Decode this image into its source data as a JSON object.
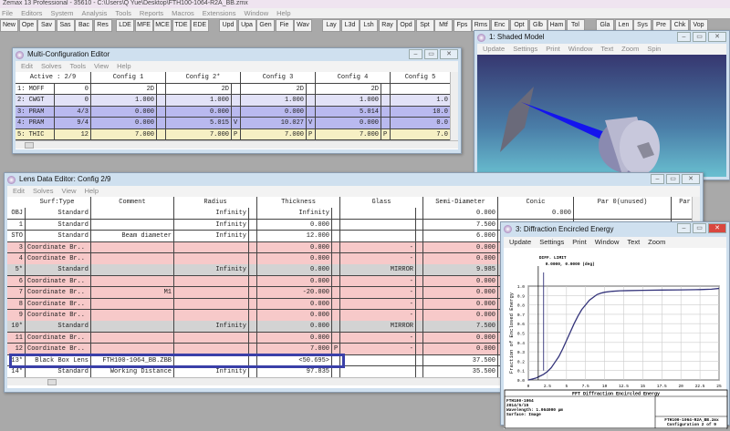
{
  "app": {
    "title": "Zemax 13 Professional - 35610 - C:\\Users\\Q Yue\\Desktop\\FTH100-1064-R2A_BB.zmx",
    "menu": [
      "File",
      "Editors",
      "System",
      "Analysis",
      "Tools",
      "Reports",
      "Macros",
      "Extensions",
      "Window",
      "Help"
    ],
    "toolbar": [
      [
        "New",
        "Ope",
        "Sav",
        "Sas",
        "Bac",
        "Res"
      ],
      [
        "LDE",
        "MFE",
        "MCE",
        "TDE",
        "EDE"
      ],
      [
        "Upd",
        "Upa",
        "Gen",
        "Fie",
        "Wav"
      ],
      [
        "Lay",
        "L3d",
        "Lsh",
        "Ray",
        "Opd",
        "Spt",
        "Mtf",
        "Fps",
        "Rms",
        "Enc"
      ],
      [
        "Opt",
        "Glb",
        "Ham",
        "Tol"
      ],
      [
        "Gla",
        "Len",
        "Sys",
        "Pre",
        "Chk",
        "Vop"
      ]
    ]
  },
  "mce": {
    "title": "Multi-Configuration Editor",
    "menu": [
      "Edit",
      "Solves",
      "Tools",
      "View",
      "Help"
    ],
    "headers": [
      "Active : 2/9",
      "Config 1",
      "Config 2*",
      "Config 3",
      "Config 4",
      "Config 5"
    ],
    "rows": [
      {
        "op": "1: MOFF",
        "val": "0",
        "cfg": [
          "2D",
          "2D",
          "2D",
          "2D",
          ""
        ],
        "sv": [
          "",
          "",
          "",
          "",
          ""
        ],
        "color": "#ffffff"
      },
      {
        "op": "2: CWGT",
        "val": "0",
        "cfg": [
          "1.000",
          "1.000",
          "1.000",
          "1.000",
          "1.0"
        ],
        "sv": [
          "",
          "",
          "",
          "",
          ""
        ],
        "color": "#e2e2f7"
      },
      {
        "op": "3: PRAM",
        "val": "4/3",
        "cfg": [
          "0.000",
          "0.000",
          "0.000",
          "5.014",
          "10.0"
        ],
        "sv": [
          "",
          "",
          "",
          "",
          ""
        ],
        "color": "#b9b9ef"
      },
      {
        "op": "4: PRAM",
        "val": "9/4",
        "cfg": [
          "0.000",
          "5.015",
          "10.027",
          "0.000",
          "0.0"
        ],
        "sv": [
          "",
          "V",
          "V",
          "",
          ""
        ],
        "color": "#b9b9ef"
      },
      {
        "op": "5: THIC",
        "val": "12",
        "cfg": [
          "7.000",
          "7.000",
          "7.000",
          "7.000",
          "7.0"
        ],
        "sv": [
          "",
          "P",
          "P",
          "P",
          ""
        ],
        "color": "#f6f0c4"
      }
    ]
  },
  "shaded": {
    "title": "1: Shaded Model",
    "menu": [
      "Update",
      "Settings",
      "Print",
      "Window",
      "Text",
      "Zoom",
      "Spin"
    ]
  },
  "lde": {
    "title": "Lens Data Editor: Config 2/9",
    "menu": [
      "Edit",
      "Solves",
      "View",
      "Help"
    ],
    "headers": [
      "Surf:Type",
      "Comment",
      "Radius",
      "Thickness",
      "Glass",
      "Semi-Diameter",
      "Conic",
      "Par 0(unused)",
      "Par"
    ],
    "rows": [
      {
        "n": "OBJ",
        "type": "Standard",
        "comment": "",
        "radius": "Infinity",
        "thick": "Infinity",
        "ts": "",
        "glass": "",
        "semi": "0.000",
        "conic": "0.000",
        "color": "#ffffff"
      },
      {
        "n": "1",
        "type": "Standard",
        "comment": "",
        "radius": "Infinity",
        "thick": "0.000",
        "ts": "",
        "glass": "",
        "semi": "7.500",
        "conic": "",
        "color": "#ffffff"
      },
      {
        "n": "STO",
        "type": "Standard",
        "comment": "Beam diameter",
        "radius": "Infinity",
        "thick": "12.000",
        "ts": "",
        "glass": "",
        "semi": "6.000",
        "conic": "",
        "color": "#ffffff"
      },
      {
        "n": "3",
        "type": "Coordinate Br..",
        "comment": "",
        "radius": "",
        "thick": "0.000",
        "ts": "",
        "glass": "-",
        "semi": "0.000",
        "conic": "",
        "color": "#f7c9c9"
      },
      {
        "n": "4",
        "type": "Coordinate Br..",
        "comment": "",
        "radius": "",
        "thick": "0.000",
        "ts": "",
        "glass": "-",
        "semi": "0.000",
        "conic": "",
        "color": "#f7c9c9"
      },
      {
        "n": "5*",
        "type": "Standard",
        "comment": "",
        "radius": "Infinity",
        "thick": "0.000",
        "ts": "",
        "glass": "MIRROR",
        "semi": "9.985",
        "conic": "",
        "color": "#d3d3d3"
      },
      {
        "n": "6",
        "type": "Coordinate Br..",
        "comment": "",
        "radius": "",
        "thick": "0.000",
        "ts": "",
        "glass": "-",
        "semi": "0.000",
        "conic": "",
        "color": "#f7c9c9"
      },
      {
        "n": "7",
        "type": "Coordinate Br..",
        "comment": "M1",
        "radius": "",
        "thick": "-20.000",
        "ts": "",
        "glass": "-",
        "semi": "0.000",
        "conic": "",
        "color": "#f7c9c9"
      },
      {
        "n": "8",
        "type": "Coordinate Br..",
        "comment": "",
        "radius": "",
        "thick": "0.000",
        "ts": "",
        "glass": "-",
        "semi": "0.000",
        "conic": "",
        "color": "#f7c9c9"
      },
      {
        "n": "9",
        "type": "Coordinate Br..",
        "comment": "",
        "radius": "",
        "thick": "0.000",
        "ts": "",
        "glass": "-",
        "semi": "0.000",
        "conic": "",
        "color": "#f7c9c9"
      },
      {
        "n": "10*",
        "type": "Standard",
        "comment": "",
        "radius": "Infinity",
        "thick": "0.000",
        "ts": "",
        "glass": "MIRROR",
        "semi": "7.500",
        "conic": "",
        "color": "#d3d3d3"
      },
      {
        "n": "11",
        "type": "Coordinate Br..",
        "comment": "",
        "radius": "",
        "thick": "0.000",
        "ts": "",
        "glass": "-",
        "semi": "0.000",
        "conic": "",
        "color": "#f7c9c9"
      },
      {
        "n": "12",
        "type": "Coordinate Br..",
        "comment": "",
        "radius": "",
        "thick": "7.000",
        "ts": "P",
        "glass": "-",
        "semi": "0.000",
        "conic": "",
        "color": "#f7c9c9"
      },
      {
        "n": "13*",
        "type": "Black Box Lens",
        "comment": "FTH100-1064_BB.ZBB",
        "radius": "",
        "thick": "<50.695>",
        "ts": "",
        "glass": "",
        "semi": "37.500",
        "conic": "",
        "color": "#ffffff"
      },
      {
        "n": "14*",
        "type": "Standard",
        "comment": "Working Distance",
        "radius": "Infinity",
        "thick": "97.835",
        "ts": "",
        "glass": "",
        "semi": "35.500",
        "conic": "",
        "color": "#ffffff"
      }
    ]
  },
  "diff": {
    "title": "3: Diffraction Encircled Energy",
    "menu": [
      "Update",
      "Settings",
      "Print",
      "Window",
      "Text",
      "Zoom"
    ],
    "footer_title": "FFT Diffraction Encircled Energy",
    "footer_left": [
      "FTH100-1064",
      "2014/5/15",
      "Wavelength: 1.064000 µm",
      "Surface: Image"
    ],
    "footer_right": [
      "FTH100-1064-R2A_BB.zmx",
      "Configuration 2 of 9"
    ]
  },
  "chart_data": {
    "type": "line",
    "title": "",
    "xlabel": "Radius From Centroid in µm",
    "ylabel": "Fraction of Enclosed Energy",
    "xlim": [
      0,
      25
    ],
    "ylim": [
      0,
      1
    ],
    "grid": true,
    "xticks": [
      "0",
      "2.5",
      "5",
      "7.5",
      "10",
      "12.5",
      "15",
      "17.5",
      "20",
      "22.5",
      "25"
    ],
    "yticks": [
      "0.0",
      "0.1",
      "0.2",
      "0.3",
      "0.4",
      "0.5",
      "0.6",
      "0.7",
      "0.8",
      "0.9",
      "1.0"
    ],
    "annotations": [
      "DIFF. LIMIT",
      "0.0000, 0.0000 (deg)"
    ],
    "diff_limit_x": [
      1.3,
      2.0
    ],
    "series": [
      {
        "x": [
          0,
          0.5,
          1,
          1.5,
          2,
          2.5,
          3,
          3.5,
          4,
          4.5,
          5,
          5.5,
          6,
          6.5,
          7,
          7.5,
          8,
          8.5,
          9,
          9.5,
          10,
          11,
          12,
          13,
          15,
          17.5,
          20,
          22.5,
          24,
          25
        ],
        "y": [
          0,
          0.01,
          0.02,
          0.04,
          0.06,
          0.09,
          0.13,
          0.19,
          0.25,
          0.33,
          0.42,
          0.51,
          0.6,
          0.68,
          0.75,
          0.8,
          0.85,
          0.88,
          0.91,
          0.925,
          0.935,
          0.945,
          0.95,
          0.952,
          0.955,
          0.958,
          0.96,
          0.963,
          0.967,
          0.975
        ],
        "color": "#33337a"
      }
    ]
  }
}
